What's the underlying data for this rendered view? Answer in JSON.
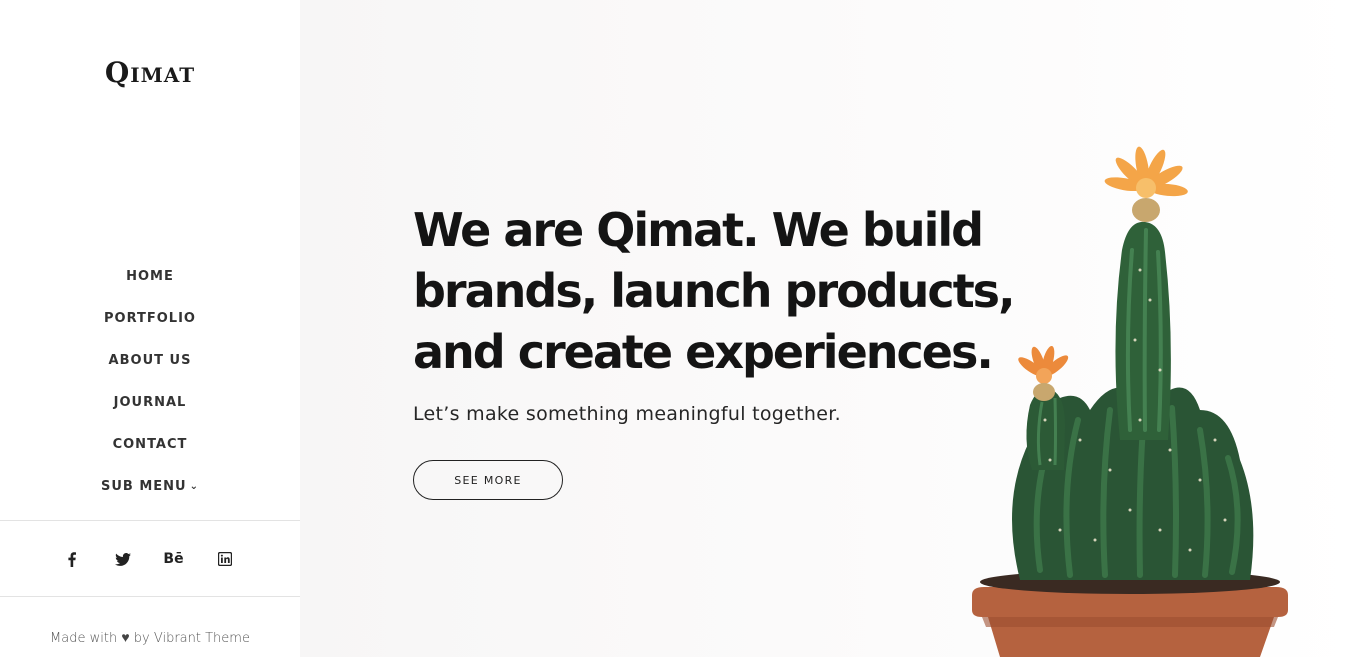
{
  "brand": {
    "logo": "Qimat"
  },
  "nav": {
    "items": [
      {
        "label": "HOME"
      },
      {
        "label": "PORTFOLIO"
      },
      {
        "label": "ABOUT US"
      },
      {
        "label": "JOURNAL"
      },
      {
        "label": "CONTACT"
      },
      {
        "label": "SUB MENU"
      }
    ]
  },
  "social": {
    "behance_label": "Bē",
    "icons": [
      "facebook-icon",
      "twitter-icon",
      "behance-icon",
      "linkedin-icon"
    ]
  },
  "footer": {
    "made_with": "Made with",
    "by": "by Vibrant Theme"
  },
  "hero": {
    "headline": "We are Qimat. We build brands, launch products, and create experiences.",
    "subheadline": "Let’s make something meaningful together.",
    "cta_label": "SEE MORE"
  },
  "colors": {
    "text": "#141414",
    "pot": "#b5623f",
    "cactus": "#2f5e3a",
    "flower": "#f4a548"
  }
}
